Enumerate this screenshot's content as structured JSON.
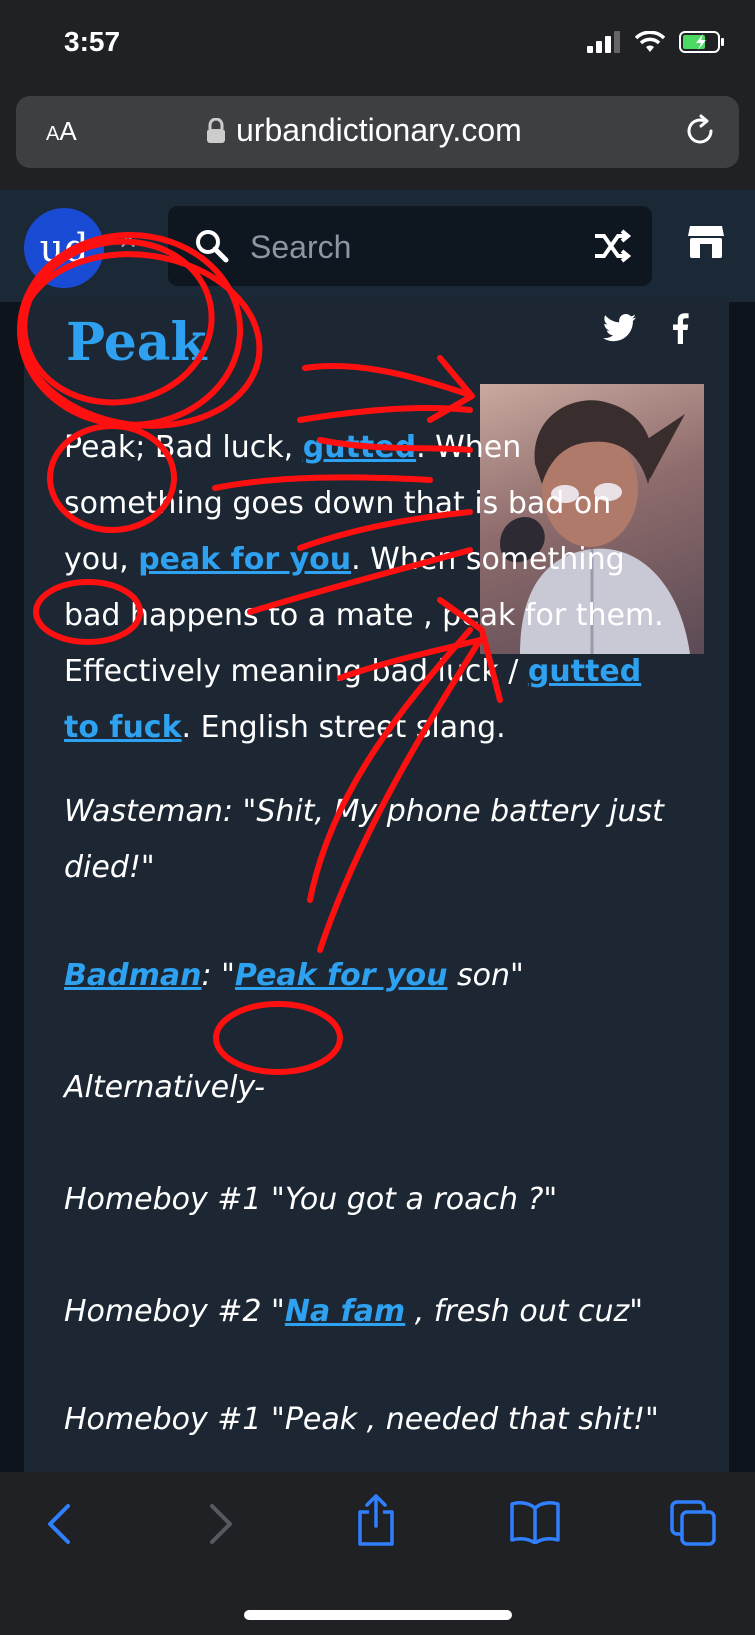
{
  "status": {
    "time": "3:57"
  },
  "browser": {
    "aa_big": "A",
    "aa_small": "A",
    "url": "urbandictionary.com"
  },
  "header": {
    "logo": "ud",
    "search_placeholder": "Search"
  },
  "entry": {
    "title": "Peak",
    "definition": {
      "t1": "Peak; Bad luck, ",
      "l1": "gutted",
      "t2": ". When something goes down that is bad on you, ",
      "l2": "peak for you",
      "t3": ". When something bad happens to a mate , peak for them. Effectively meaning bad luck / ",
      "l3": "gutted to fuck",
      "t4": ". English street slang."
    },
    "example": {
      "line1": "Wasteman: \"Shit, My phone battery just died!\"",
      "l4": "Badman",
      "t5": ": \"",
      "l5": "Peak for you",
      "t6": " son\"",
      "line3": "Alternatively-",
      "line4": "Homeboy #1 \"You got a roach ?\"",
      "t7": "Homeboy #2 \"",
      "l6": "Na fam",
      "t8": " , fresh out cuz\"",
      "line6": "Homeboy #1 \"Peak , needed that shit!\""
    }
  },
  "icons": [
    "signal-icon",
    "wifi-icon",
    "battery-icon",
    "lock-icon",
    "reload-icon",
    "search-icon",
    "shuffle-icon",
    "store-icon",
    "twitter-icon",
    "facebook-icon",
    "back-icon",
    "forward-icon",
    "share-icon",
    "bookmarks-icon",
    "tabs-icon"
  ],
  "colors": {
    "link": "#2ea1f0",
    "card": "#1c2733",
    "logo": "#1a4bd4",
    "annotation": "#ff0000"
  }
}
